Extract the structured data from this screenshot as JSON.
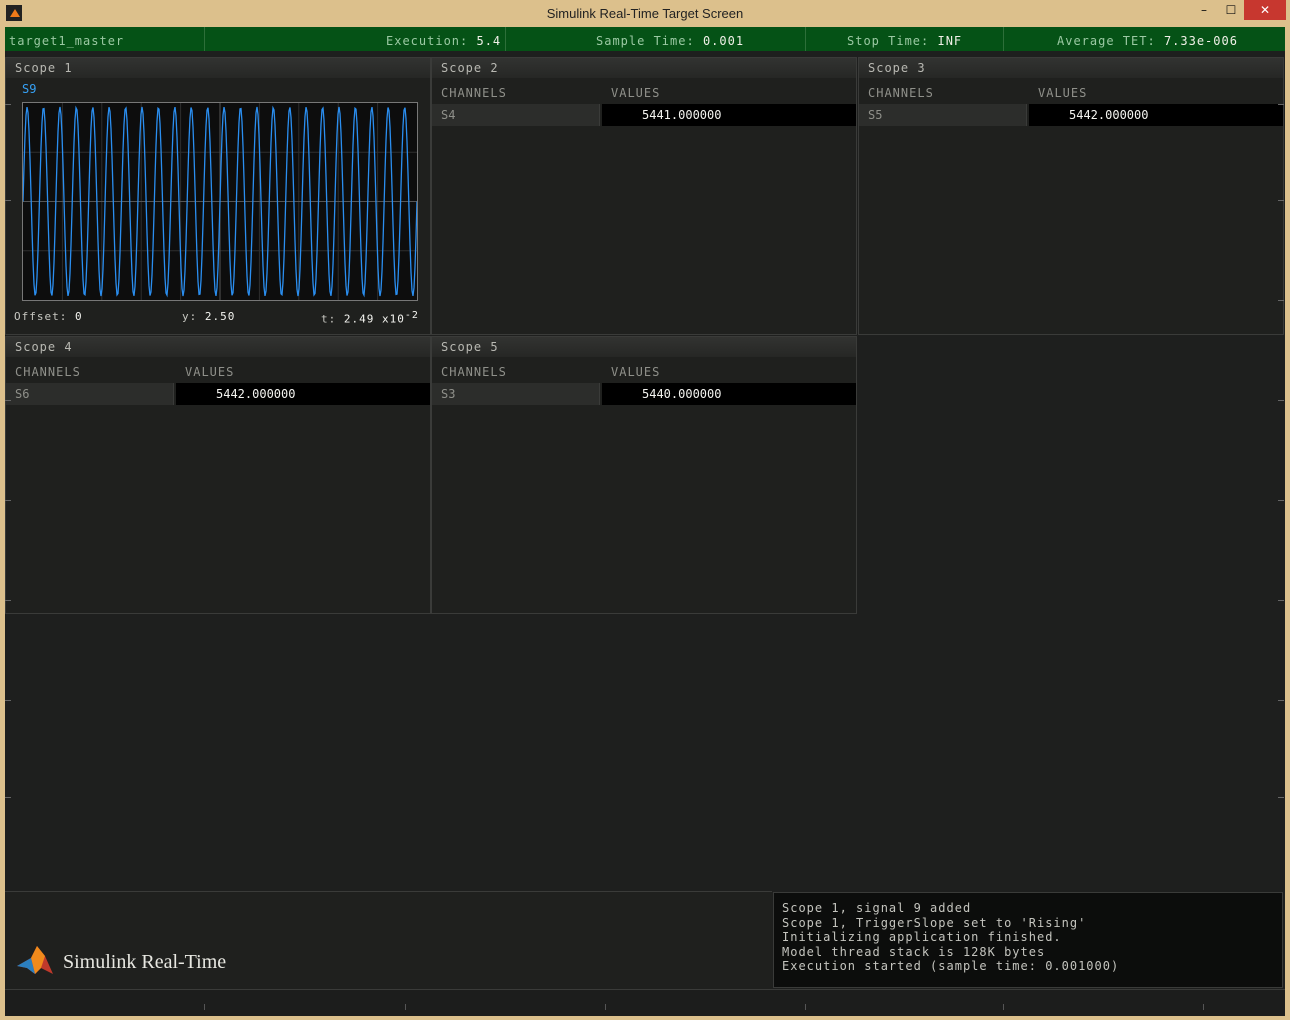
{
  "window": {
    "title": "Simulink Real-Time Target Screen",
    "minimize_glyph": "–",
    "maximize_glyph": "☐",
    "close_glyph": "✕"
  },
  "status": {
    "target": "target1_master",
    "execution_label": "Execution:",
    "execution_value": "5.4",
    "sample_label": "Sample Time:",
    "sample_value": "0.001",
    "stop_label": "Stop Time:",
    "stop_value": "INF",
    "tet_label": "Average TET:",
    "tet_value": "7.33e-006"
  },
  "scope1": {
    "title": "Scope 1",
    "signal": "S9",
    "offset_label": "Offset:",
    "offset_value": "0",
    "y_label": "y:",
    "y_value": "2.50",
    "t_label": "t:",
    "t_value": "2.49",
    "t_mult": "x10",
    "t_exp": "-2",
    "trace_color": "#2a8ef0"
  },
  "scope2": {
    "title": "Scope 2",
    "col_channels": "CHANNELS",
    "col_values": "VALUES",
    "channel": "S4",
    "value": "5441.000000"
  },
  "scope3": {
    "title": "Scope 3",
    "col_channels": "CHANNELS",
    "col_values": "VALUES",
    "channel": "S5",
    "value": "5442.000000"
  },
  "scope4": {
    "title": "Scope 4",
    "col_channels": "CHANNELS",
    "col_values": "VALUES",
    "channel": "S6",
    "value": "5442.000000"
  },
  "scope5": {
    "title": "Scope 5",
    "col_channels": "CHANNELS",
    "col_values": "VALUES",
    "channel": "S3",
    "value": "5440.000000"
  },
  "logo": {
    "text": "Simulink Real-Time",
    "icon": "matlab-membrane-icon"
  },
  "console": {
    "lines": [
      "Scope 1, signal 9 added",
      "Scope 1, TriggerSlope set to 'Rising'",
      "Initializing application finished.",
      "Model thread stack is 128K bytes",
      "Execution started (sample time: 0.001000)"
    ]
  }
}
